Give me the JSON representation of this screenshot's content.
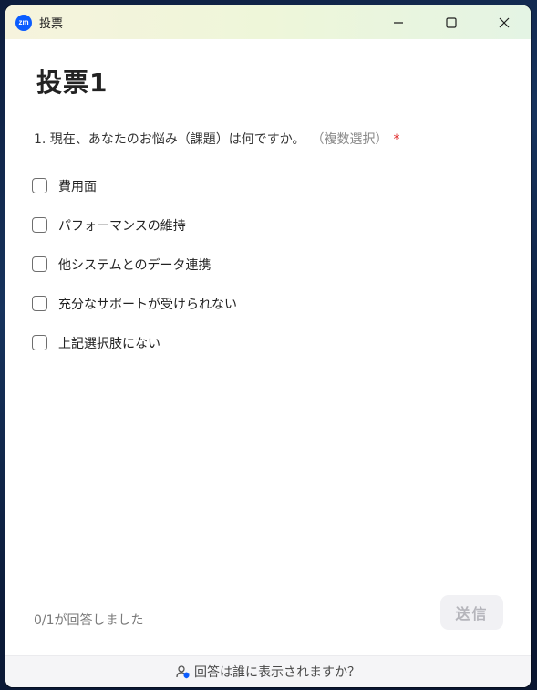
{
  "window": {
    "app_logo_text": "zm",
    "title": "投票",
    "controls": {
      "minimize_icon": "minimize-icon",
      "maximize_icon": "maximize-icon",
      "close_icon": "close-icon"
    }
  },
  "poll": {
    "title": "投票1",
    "question": {
      "text": "1. 現在、あなたのお悩み（課題）は何ですか。",
      "hint": "（複数選択）",
      "required_mark": "*"
    },
    "options": [
      {
        "label": "費用面",
        "checked": false
      },
      {
        "label": "パフォーマンスの維持",
        "checked": false
      },
      {
        "label": "他システムとのデータ連携",
        "checked": false
      },
      {
        "label": "充分なサポートが受けられない",
        "checked": false
      },
      {
        "label": "上記選択肢にない",
        "checked": false
      }
    ]
  },
  "footer": {
    "status": "0/1が回答しました",
    "submit_label": "送信"
  },
  "bottom_bar": {
    "text": "回答は誰に表示されますか？",
    "icon": "user-shield-icon"
  },
  "colors": {
    "brand": "#0b5cff",
    "required": "#e02828",
    "submit_disabled_bg": "#f1f1f4",
    "submit_disabled_text": "#b5b5bb"
  }
}
